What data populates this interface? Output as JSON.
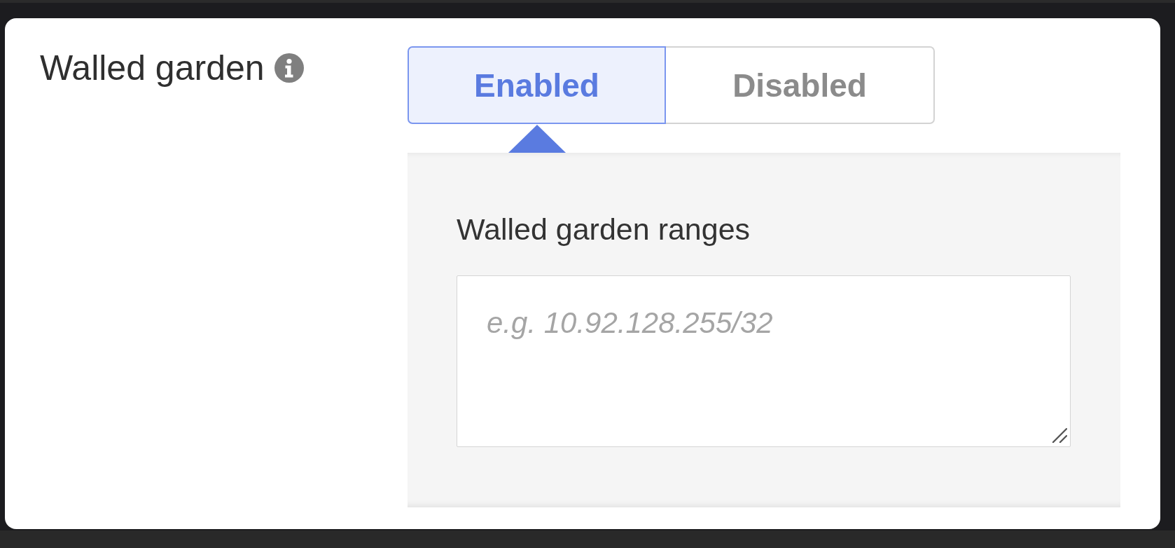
{
  "setting": {
    "label": "Walled garden"
  },
  "toggle": {
    "options": [
      {
        "label": "Enabled",
        "selected": true
      },
      {
        "label": "Disabled",
        "selected": false
      }
    ]
  },
  "ranges": {
    "label": "Walled garden ranges",
    "placeholder": "e.g. 10.92.128.255/32"
  }
}
